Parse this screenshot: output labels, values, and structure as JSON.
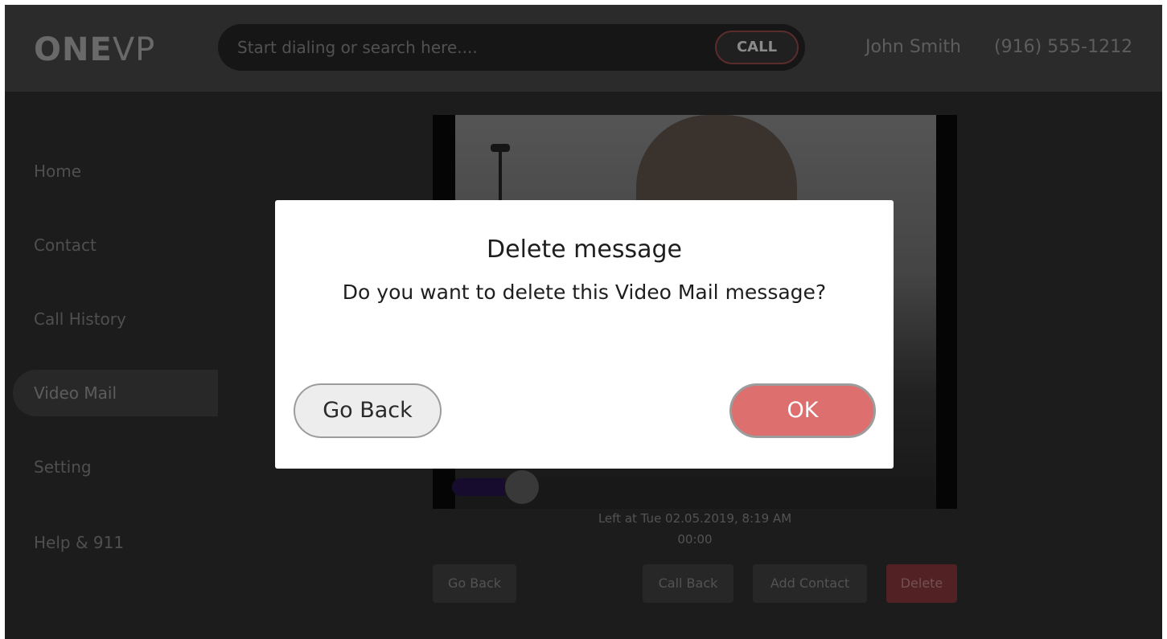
{
  "header": {
    "logo_bold": "ONE",
    "logo_light": "VP",
    "search_placeholder": "Start dialing or search here....",
    "call_label": "CALL",
    "user_name": "John Smith",
    "user_phone": "(916) 555-1212"
  },
  "sidebar": {
    "items": [
      {
        "label": "Home"
      },
      {
        "label": "Contact"
      },
      {
        "label": "Call History"
      },
      {
        "label": "Video Mail"
      },
      {
        "label": "Setting"
      },
      {
        "label": "Help & 911"
      }
    ],
    "active": "Video Mail"
  },
  "video": {
    "left_at": "Left at Tue 02.05.2019, 8:19 AM",
    "duration": "00:00",
    "progress_fraction": 0.11
  },
  "actions": {
    "go_back": "Go Back",
    "call_back": "Call Back",
    "add_contact": "Add Contact",
    "delete": "Delete"
  },
  "modal": {
    "title": "Delete message",
    "text": "Do you want to delete this Video Mail message?",
    "go_back": "Go Back",
    "ok": "OK"
  },
  "colors": {
    "accent_ok": "#de6f6f",
    "delete_button": "#6e2d31",
    "progress_fill": "#3a1e6e"
  }
}
